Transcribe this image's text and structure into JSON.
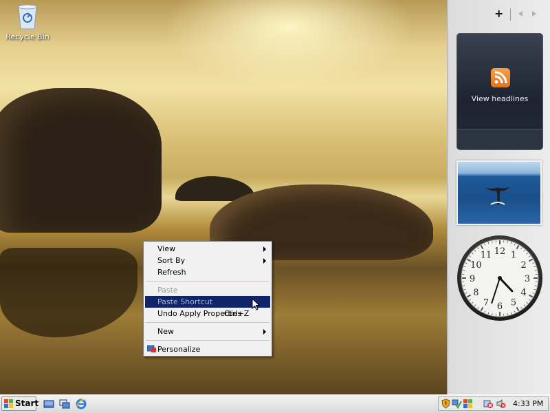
{
  "desktop": {
    "icons": [
      {
        "label": "Recycle Bin",
        "icon": "recycle-bin-icon"
      }
    ]
  },
  "context_menu": {
    "items": [
      {
        "label": "View",
        "submenu": true,
        "enabled": true
      },
      {
        "label": "Sort By",
        "submenu": true,
        "enabled": true
      },
      {
        "label": "Refresh",
        "enabled": true
      },
      {
        "label": "Paste",
        "enabled": false
      },
      {
        "label": "Paste Shortcut",
        "enabled": false,
        "highlighted": true
      },
      {
        "label": "Undo Apply Properties",
        "accelerator": "Ctrl+Z",
        "enabled": true
      },
      {
        "label": "New",
        "submenu": true,
        "enabled": true
      },
      {
        "label": "Personalize",
        "icon": "personalize-icon",
        "enabled": true
      }
    ]
  },
  "sidebar": {
    "controls": {
      "add_label": "+"
    },
    "gadgets": {
      "headlines": {
        "label": "View headlines",
        "icon": "rss-icon"
      },
      "slideshow": {
        "image": "whale-tail"
      },
      "clock": {
        "hour": 4,
        "minute": 33
      }
    }
  },
  "taskbar": {
    "start_label": "Start",
    "quick_launch": [
      "show-desktop-icon",
      "switch-windows-icon",
      "internet-explorer-icon"
    ],
    "tray_icons": [
      "security-shield-icon",
      "network-icon",
      "windows-update-icon",
      "error-icon",
      "volume-muted-icon"
    ],
    "clock": "4:33 PM"
  },
  "colors": {
    "menu_highlight": "#10246a",
    "sidebar_bg": "#e4e4e4",
    "rss_orange": "#f08a32"
  }
}
